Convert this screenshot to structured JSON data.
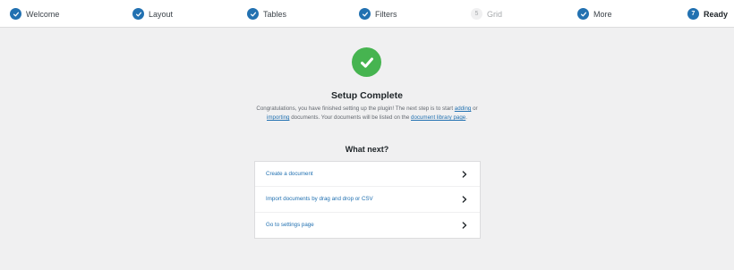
{
  "steps": [
    {
      "label": "Welcome",
      "state": "done"
    },
    {
      "label": "Layout",
      "state": "done"
    },
    {
      "label": "Tables",
      "state": "done"
    },
    {
      "label": "Filters",
      "state": "done"
    },
    {
      "label": "Grid",
      "state": "future",
      "number": "5"
    },
    {
      "label": "More",
      "state": "done"
    },
    {
      "label": "Ready",
      "state": "current",
      "number": "7"
    }
  ],
  "main": {
    "title": "Setup Complete",
    "desc_1": "Congratulations, you have finished setting up the plugin! The next step is to start",
    "adding_link": "adding",
    "desc_or": "or",
    "importing_link": "importing",
    "desc_2": "documents. Your documents will be listed on the",
    "library_link": "document library page",
    "desc_end": ".",
    "next_title": "What next?",
    "options": [
      {
        "label": "Create a document"
      },
      {
        "label": "Import documents by drag and drop or CSV"
      },
      {
        "label": "Go to settings page"
      }
    ]
  },
  "colors": {
    "accent": "#2271b1",
    "success": "#46b450",
    "background": "#f0f0f1"
  },
  "icons": {
    "step_done": "check-icon",
    "complete": "checkmark-circle-icon",
    "option_arrow": "chevron-right-icon"
  }
}
